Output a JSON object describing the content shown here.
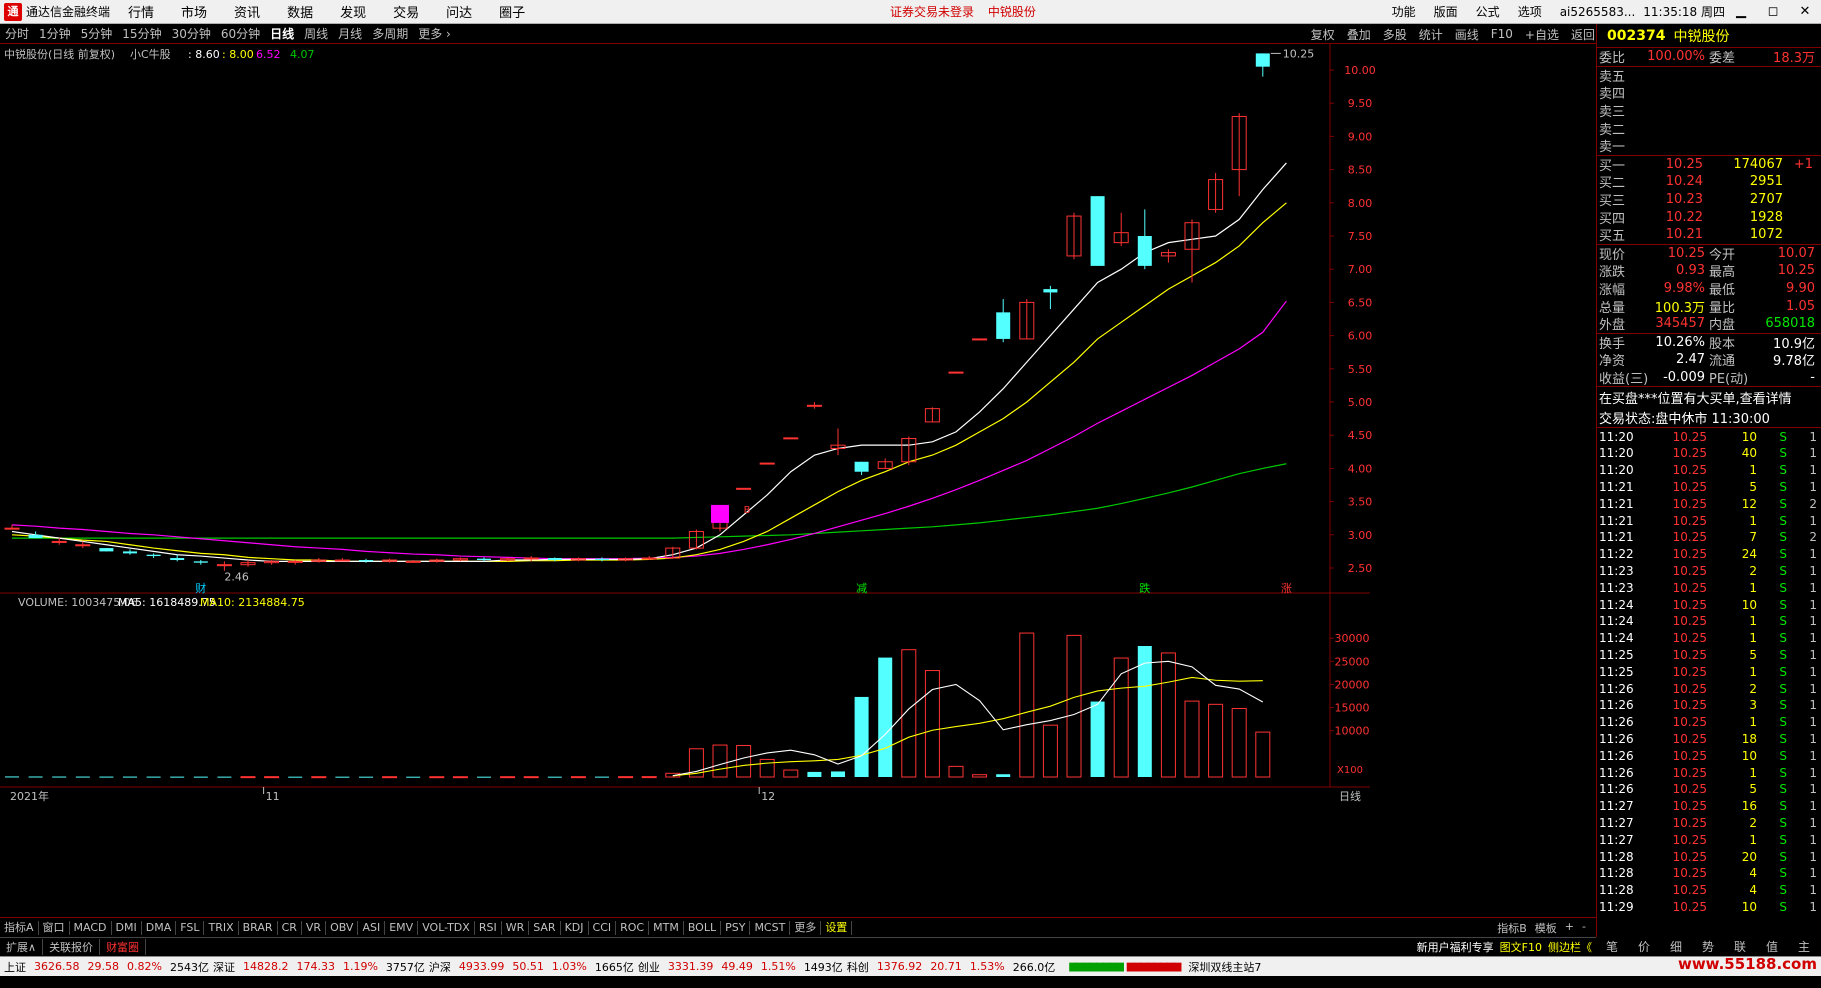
{
  "menubar": {
    "logo": "通",
    "app_name": "通达信金融终端",
    "items": [
      "行情",
      "市场",
      "资讯",
      "数据",
      "发现",
      "交易",
      "问达",
      "圈子"
    ],
    "center": [
      "证券交易未登录",
      "中锐股份"
    ],
    "right_items": [
      "功能",
      "版面",
      "公式",
      "选项"
    ],
    "account": "ai5265583...",
    "time": "11:35:18 周四",
    "win_buttons": [
      "▁",
      "◻",
      "✕"
    ]
  },
  "periodbar": {
    "periods": [
      "分时",
      "1分钟",
      "5分钟",
      "15分钟",
      "30分钟",
      "60分钟",
      "日线",
      "周线",
      "月线",
      "多周期",
      "更多 ›"
    ],
    "active": "日线",
    "tools": [
      "复权",
      "叠加",
      "多股",
      "统计",
      "画线",
      "F10",
      "+自选",
      "返回"
    ]
  },
  "chart": {
    "header_name": "中锐股份(日线 前复权)",
    "indicator": "小C牛股",
    "ma_vals": [
      ": 8.60",
      ": 8.00",
      "6.52",
      "4.07"
    ],
    "price_labels": [
      "10.00",
      "9.50",
      "9.00",
      "8.50",
      "8.00",
      "7.50",
      "7.00",
      "6.50",
      "6.00",
      "5.50",
      "5.00",
      "4.50",
      "4.00",
      "3.50",
      "3.00",
      "2.50"
    ],
    "high_label": "10.25",
    "low_label": "2.46",
    "event_marks": [
      "财",
      "减",
      "跌",
      "涨"
    ],
    "buy_mark": "B",
    "vol_header": "VOLUME: 1003475.06",
    "vol_ma5": "MA5: 1618489.75",
    "vol_ma10": "MA10: 2134884.75",
    "vol_labels": [
      "30000",
      "25000",
      "20000",
      "15000",
      "10000"
    ],
    "vol_unit": "X100",
    "date_labels": [
      "2021年",
      "11",
      "12"
    ],
    "axis_mode": "日线"
  },
  "chart_data": {
    "type": "candlestick",
    "price_axis": [
      2.5,
      10.0
    ],
    "candles": [
      [
        3.1,
        3.1,
        3.1,
        3.15
      ],
      [
        3.0,
        2.95,
        2.95,
        3.05
      ],
      [
        2.9,
        2.9,
        2.85,
        2.95
      ],
      [
        2.85,
        2.85,
        2.8,
        2.9
      ],
      [
        2.8,
        2.75,
        2.75,
        2.8
      ],
      [
        2.75,
        2.72,
        2.7,
        2.78
      ],
      [
        2.7,
        2.68,
        2.65,
        2.72
      ],
      [
        2.65,
        2.62,
        2.6,
        2.7
      ],
      [
        2.6,
        2.58,
        2.55,
        2.62
      ],
      [
        2.55,
        2.55,
        2.46,
        2.6
      ],
      [
        2.55,
        2.58,
        2.52,
        2.62
      ],
      [
        2.58,
        2.6,
        2.55,
        2.62
      ],
      [
        2.6,
        2.6,
        2.55,
        2.62
      ],
      [
        2.6,
        2.62,
        2.58,
        2.65
      ],
      [
        2.62,
        2.62,
        2.6,
        2.65
      ],
      [
        2.62,
        2.6,
        2.58,
        2.64
      ],
      [
        2.6,
        2.62,
        2.58,
        2.64
      ],
      [
        2.6,
        2.6,
        2.58,
        2.62
      ],
      [
        2.6,
        2.62,
        2.58,
        2.64
      ],
      [
        2.62,
        2.64,
        2.6,
        2.66
      ],
      [
        2.64,
        2.62,
        2.6,
        2.66
      ],
      [
        2.62,
        2.64,
        2.6,
        2.66
      ],
      [
        2.64,
        2.65,
        2.6,
        2.68
      ],
      [
        2.65,
        2.62,
        2.6,
        2.66
      ],
      [
        2.62,
        2.64,
        2.6,
        2.66
      ],
      [
        2.64,
        2.62,
        2.6,
        2.66
      ],
      [
        2.62,
        2.64,
        2.6,
        2.66
      ],
      [
        2.64,
        2.65,
        2.62,
        2.68
      ],
      [
        2.65,
        2.8,
        2.64,
        2.82
      ],
      [
        2.8,
        3.05,
        2.78,
        3.08
      ],
      [
        3.1,
        3.35,
        3.05,
        3.4
      ],
      [
        3.7,
        3.7,
        3.7,
        3.7
      ],
      [
        4.08,
        4.08,
        4.08,
        4.08
      ],
      [
        4.46,
        4.46,
        4.46,
        4.46
      ],
      [
        4.95,
        4.95,
        4.9,
        5.0
      ],
      [
        4.3,
        4.35,
        4.2,
        4.6
      ],
      [
        4.1,
        3.95,
        3.9,
        4.1
      ],
      [
        4.0,
        4.1,
        4.0,
        4.15
      ],
      [
        4.1,
        4.45,
        4.05,
        4.48
      ],
      [
        4.7,
        4.9,
        4.7,
        4.92
      ],
      [
        5.45,
        5.45,
        5.45,
        5.45
      ],
      [
        5.95,
        5.95,
        5.95,
        5.95
      ],
      [
        6.35,
        5.95,
        5.9,
        6.55
      ],
      [
        5.95,
        6.5,
        5.95,
        6.55
      ],
      [
        6.7,
        6.65,
        6.4,
        6.75
      ],
      [
        7.2,
        7.8,
        7.15,
        7.85
      ],
      [
        8.1,
        7.05,
        7.05,
        8.1
      ],
      [
        7.4,
        7.55,
        7.35,
        7.85
      ],
      [
        7.5,
        7.05,
        7.0,
        7.9
      ],
      [
        7.2,
        7.25,
        7.1,
        7.3
      ],
      [
        7.3,
        7.7,
        6.8,
        7.75
      ],
      [
        7.9,
        8.35,
        7.85,
        8.45
      ],
      [
        8.5,
        9.3,
        8.1,
        9.35
      ],
      [
        10.25,
        10.05,
        9.9,
        10.25
      ]
    ],
    "volume_axis": [
      0,
      35000
    ],
    "volumes": [
      120,
      110,
      100,
      95,
      90,
      90,
      85,
      80,
      80,
      80,
      75,
      75,
      70,
      70,
      70,
      70,
      70,
      65,
      65,
      65,
      70,
      70,
      70,
      70,
      75,
      80,
      80,
      85,
      800,
      6100,
      6900,
      6800,
      3800,
      1500,
      1100,
      1200,
      17300,
      25800,
      27500,
      23000,
      2300,
      500,
      600,
      31100,
      11200,
      30600,
      16300,
      25700,
      28300,
      26800,
      16400,
      15700,
      14800,
      9700
    ],
    "vol_up": [
      false,
      false,
      false,
      false,
      false,
      false,
      false,
      false,
      false,
      false,
      true,
      true,
      false,
      true,
      false,
      false,
      true,
      false,
      true,
      true,
      false,
      true,
      true,
      false,
      true,
      false,
      true,
      true,
      true,
      true,
      true,
      true,
      true,
      true,
      false,
      false,
      false,
      false,
      true,
      true,
      true,
      true,
      false,
      true,
      true,
      true,
      false,
      true,
      false,
      true,
      true,
      true,
      true,
      true
    ],
    "ma_white": [
      3.05,
      3.0,
      2.95,
      2.9,
      2.85,
      2.8,
      2.75,
      2.7,
      2.68,
      2.65,
      2.62,
      2.6,
      2.6,
      2.6,
      2.6,
      2.6,
      2.6,
      2.6,
      2.6,
      2.6,
      2.6,
      2.62,
      2.62,
      2.63,
      2.63,
      2.63,
      2.63,
      2.64,
      2.7,
      2.8,
      3.0,
      3.3,
      3.6,
      3.95,
      4.2,
      4.3,
      4.35,
      4.35,
      4.35,
      4.4,
      4.55,
      4.85,
      5.2,
      5.6,
      6.0,
      6.4,
      6.8,
      7.0,
      7.25,
      7.4,
      7.45,
      7.5,
      7.75,
      8.2,
      8.6
    ],
    "ma_yellow": [
      3.0,
      2.98,
      2.95,
      2.92,
      2.9,
      2.85,
      2.8,
      2.76,
      2.72,
      2.7,
      2.66,
      2.64,
      2.62,
      2.62,
      2.6,
      2.6,
      2.6,
      2.6,
      2.6,
      2.6,
      2.6,
      2.6,
      2.61,
      2.61,
      2.62,
      2.62,
      2.62,
      2.63,
      2.65,
      2.7,
      2.78,
      2.9,
      3.05,
      3.25,
      3.45,
      3.65,
      3.82,
      3.95,
      4.1,
      4.2,
      4.35,
      4.55,
      4.75,
      5.0,
      5.3,
      5.6,
      5.95,
      6.2,
      6.45,
      6.7,
      6.9,
      7.1,
      7.35,
      7.7,
      8.0
    ],
    "ma_magenta": [
      3.15,
      3.13,
      3.1,
      3.08,
      3.05,
      3.02,
      3.0,
      2.97,
      2.94,
      2.91,
      2.88,
      2.85,
      2.82,
      2.8,
      2.78,
      2.75,
      2.73,
      2.71,
      2.7,
      2.68,
      2.67,
      2.66,
      2.65,
      2.64,
      2.64,
      2.64,
      2.64,
      2.65,
      2.66,
      2.68,
      2.72,
      2.78,
      2.85,
      2.93,
      3.02,
      3.12,
      3.22,
      3.32,
      3.43,
      3.55,
      3.68,
      3.82,
      3.97,
      4.12,
      4.3,
      4.48,
      4.68,
      4.86,
      5.04,
      5.22,
      5.4,
      5.6,
      5.8,
      6.05,
      6.52
    ],
    "ma_green": [
      2.95,
      2.95,
      2.95,
      2.95,
      2.95,
      2.95,
      2.95,
      2.95,
      2.95,
      2.95,
      2.95,
      2.95,
      2.95,
      2.95,
      2.95,
      2.95,
      2.95,
      2.95,
      2.95,
      2.95,
      2.95,
      2.95,
      2.95,
      2.95,
      2.95,
      2.95,
      2.95,
      2.95,
      2.95,
      2.96,
      2.97,
      2.98,
      2.99,
      3.0,
      3.02,
      3.04,
      3.06,
      3.08,
      3.1,
      3.12,
      3.15,
      3.18,
      3.22,
      3.26,
      3.3,
      3.35,
      3.4,
      3.47,
      3.55,
      3.63,
      3.72,
      3.82,
      3.92,
      4.0,
      4.07
    ],
    "vol_ma5": [
      null,
      null,
      null,
      null,
      null,
      null,
      null,
      null,
      null,
      null,
      null,
      null,
      null,
      null,
      null,
      null,
      null,
      null,
      null,
      null,
      null,
      null,
      null,
      null,
      null,
      null,
      null,
      null,
      300,
      1200,
      2700,
      4100,
      5200,
      5800,
      4800,
      2800,
      4600,
      9200,
      14700,
      18900,
      20000,
      16500,
      10200,
      11300,
      12200,
      13500,
      15700,
      22300,
      24600,
      25000,
      23800,
      19800,
      19000,
      16200
    ],
    "vol_ma10": [
      null,
      null,
      null,
      null,
      null,
      null,
      null,
      null,
      null,
      null,
      null,
      null,
      null,
      null,
      null,
      null,
      null,
      null,
      null,
      null,
      null,
      null,
      null,
      null,
      null,
      null,
      null,
      null,
      250,
      800,
      1700,
      2500,
      3000,
      3300,
      3500,
      3800,
      4700,
      6200,
      8600,
      10100,
      10900,
      11600,
      12600,
      14000,
      15300,
      17200,
      18600,
      19200,
      19600,
      20500,
      21500,
      20900,
      20700,
      20800
    ]
  },
  "quote": {
    "code": "002374",
    "name": "中锐股份",
    "wb_label": "委比",
    "wb": "100.00%",
    "wc_label": "委差",
    "wc": "18.3万",
    "asks": [
      "卖五",
      "卖四",
      "卖三",
      "卖二",
      "卖一"
    ],
    "bids": [
      {
        "l": "买一",
        "p": "10.25",
        "v": "174067",
        "d": "+1"
      },
      {
        "l": "买二",
        "p": "10.24",
        "v": "2951",
        "d": ""
      },
      {
        "l": "买三",
        "p": "10.23",
        "v": "2707",
        "d": ""
      },
      {
        "l": "买四",
        "p": "10.22",
        "v": "1928",
        "d": ""
      },
      {
        "l": "买五",
        "p": "10.21",
        "v": "1072",
        "d": ""
      }
    ],
    "stats": [
      {
        "a": "现价",
        "av": "10.25",
        "b": "今开",
        "bv": "10.07"
      },
      {
        "a": "涨跌",
        "av": "0.93",
        "b": "最高",
        "bv": "10.25"
      },
      {
        "a": "涨幅",
        "av": "9.98%",
        "b": "最低",
        "bv": "9.90"
      },
      {
        "a": "总量",
        "av": "100.3万",
        "b": "量比",
        "bv": "1.05"
      },
      {
        "a": "外盘",
        "av": "345457",
        "b": "内盘",
        "bv": "658018"
      }
    ],
    "stats2": [
      {
        "a": "换手",
        "av": "10.26%",
        "b": "股本",
        "bv": "10.9亿"
      },
      {
        "a": "净资",
        "av": "2.47",
        "b": "流通",
        "bv": "9.78亿"
      },
      {
        "a": "收益(三)",
        "av": "-0.009",
        "b": "PE(动)",
        "bv": "-"
      }
    ],
    "notice1": "在买盘***位置有大买单,查看详情",
    "notice2": "交易状态:盘中休市 11:30:00",
    "ticks": [
      [
        "11:20",
        "10.25",
        "10",
        "S",
        "1"
      ],
      [
        "11:20",
        "10.25",
        "40",
        "S",
        "1"
      ],
      [
        "11:20",
        "10.25",
        "1",
        "S",
        "1"
      ],
      [
        "11:21",
        "10.25",
        "5",
        "S",
        "1"
      ],
      [
        "11:21",
        "10.25",
        "12",
        "S",
        "2"
      ],
      [
        "11:21",
        "10.25",
        "1",
        "S",
        "1"
      ],
      [
        "11:21",
        "10.25",
        "7",
        "S",
        "2"
      ],
      [
        "11:22",
        "10.25",
        "24",
        "S",
        "1"
      ],
      [
        "11:23",
        "10.25",
        "2",
        "S",
        "1"
      ],
      [
        "11:23",
        "10.25",
        "1",
        "S",
        "1"
      ],
      [
        "11:24",
        "10.25",
        "10",
        "S",
        "1"
      ],
      [
        "11:24",
        "10.25",
        "1",
        "S",
        "1"
      ],
      [
        "11:24",
        "10.25",
        "1",
        "S",
        "1"
      ],
      [
        "11:25",
        "10.25",
        "5",
        "S",
        "1"
      ],
      [
        "11:25",
        "10.25",
        "1",
        "S",
        "1"
      ],
      [
        "11:26",
        "10.25",
        "2",
        "S",
        "1"
      ],
      [
        "11:26",
        "10.25",
        "3",
        "S",
        "1"
      ],
      [
        "11:26",
        "10.25",
        "1",
        "S",
        "1"
      ],
      [
        "11:26",
        "10.25",
        "18",
        "S",
        "1"
      ],
      [
        "11:26",
        "10.25",
        "10",
        "S",
        "1"
      ],
      [
        "11:26",
        "10.25",
        "1",
        "S",
        "1"
      ],
      [
        "11:26",
        "10.25",
        "5",
        "S",
        "1"
      ],
      [
        "11:27",
        "10.25",
        "16",
        "S",
        "1"
      ],
      [
        "11:27",
        "10.25",
        "2",
        "S",
        "1"
      ],
      [
        "11:27",
        "10.25",
        "1",
        "S",
        "1"
      ],
      [
        "11:28",
        "10.25",
        "20",
        "S",
        "1"
      ],
      [
        "11:28",
        "10.25",
        "4",
        "S",
        "1"
      ],
      [
        "11:28",
        "10.25",
        "4",
        "S",
        "1"
      ],
      [
        "11:29",
        "10.25",
        "10",
        "S",
        "1"
      ]
    ]
  },
  "indbar": {
    "items": [
      "指标A",
      "窗口",
      "MACD",
      "DMI",
      "DMA",
      "FSL",
      "TRIX",
      "BRAR",
      "CR",
      "VR",
      "OBV",
      "ASI",
      "EMV",
      "VOL-TDX",
      "RSI",
      "WR",
      "SAR",
      "KDJ",
      "CCI",
      "ROC",
      "MTM",
      "BOLL",
      "PSY",
      "MCST",
      "更多",
      "设置"
    ],
    "right": [
      "指标B",
      "模板",
      "+",
      "-"
    ]
  },
  "tabbar": {
    "tabs": [
      "扩展∧",
      "关联报价",
      "财富圈"
    ],
    "right": [
      "新用户福利专享",
      "图文F10",
      "侧边栏《"
    ]
  },
  "rtabs": [
    "笔",
    "价",
    "细",
    "势",
    "联",
    "值",
    "主"
  ],
  "statusbar": {
    "items": [
      {
        "n": "上证",
        "v": "3626.58",
        "c": "29.58",
        "p": "0.82%",
        "a": "2543亿"
      },
      {
        "n": "深证",
        "v": "14828.2",
        "c": "174.33",
        "p": "1.19%",
        "a": "3757亿"
      },
      {
        "n": "沪深",
        "v": "4933.99",
        "c": "50.51",
        "p": "1.03%",
        "a": "1665亿"
      },
      {
        "n": "创业",
        "v": "3331.39",
        "c": "49.49",
        "p": "1.51%",
        "a": "1493亿"
      },
      {
        "n": "科创",
        "v": "1376.92",
        "c": "20.71",
        "p": "1.53%",
        "a": "266.0亿"
      }
    ],
    "bars_green": "▆▆▆▆▆▆▆▆",
    "bars_red": "▆▆▆▆▆▆▆▆",
    "site": "深圳双线主站7",
    "brand": "www.55188.com"
  },
  "colors": {
    "up": "#ff3232",
    "down": "#54ffff",
    "ma1": "#ffffff",
    "ma2": "#ffff00",
    "ma3": "#ff00ff",
    "ma4": "#00c800",
    "border": "#800000"
  }
}
